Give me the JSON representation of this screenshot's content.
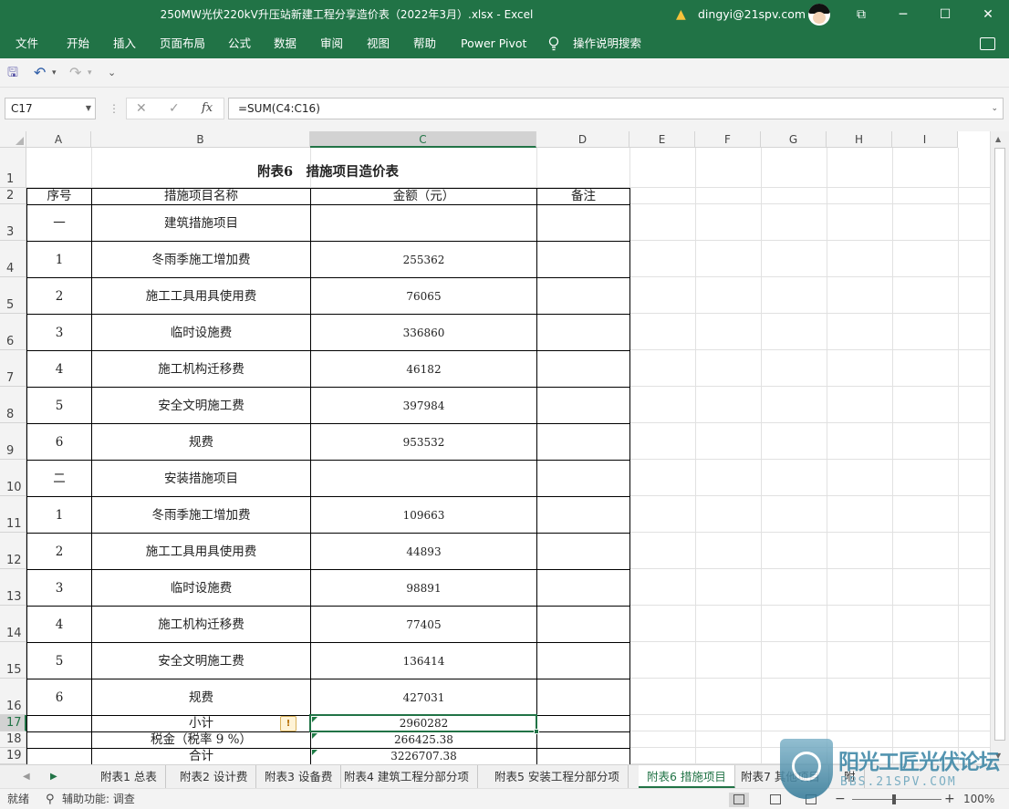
{
  "window": {
    "title": "250MW光伏220kV升压站新建工程分享造价表（2022年3月）.xlsx  -  Excel",
    "user": "dingyi@21spv.com",
    "min_glyph": "─",
    "restore_glyph": "☐",
    "close_glyph": "✕",
    "ribbon_toggle_glyph": "⧉"
  },
  "menu": [
    "文件",
    "开始",
    "插入",
    "页面布局",
    "公式",
    "数据",
    "审阅",
    "视图",
    "帮助",
    "Power Pivot",
    "操作说明搜索"
  ],
  "qat": {
    "undo": "↶",
    "redo": "↷",
    "more": "⌄",
    "save": "🖫"
  },
  "formula_bar": {
    "name_box": "C17",
    "cancel": "✕",
    "enter": "✓",
    "fx": "fx",
    "formula": "=SUM(C4:C16)"
  },
  "columns": [
    "A",
    "B",
    "C",
    "D",
    "E",
    "F",
    "G",
    "H",
    "I"
  ],
  "rows": [
    "1",
    "2",
    "3",
    "4",
    "5",
    "6",
    "7",
    "8",
    "9",
    "10",
    "11",
    "12",
    "13",
    "14",
    "15",
    "16",
    "17",
    "18",
    "19"
  ],
  "sheet": {
    "title": "附表6　措施项目造价表",
    "headers": [
      "序号",
      "措施项目名称",
      "金额（元）",
      "备注"
    ],
    "data": [
      [
        "一",
        "建筑措施项目",
        "",
        ""
      ],
      [
        "1",
        "冬雨季施工增加费",
        "255362",
        ""
      ],
      [
        "2",
        "施工工具用具使用费",
        "76065",
        ""
      ],
      [
        "3",
        "临时设施费",
        "336860",
        ""
      ],
      [
        "4",
        "施工机构迁移费",
        "46182",
        ""
      ],
      [
        "5",
        "安全文明施工费",
        "397984",
        ""
      ],
      [
        "6",
        "规费",
        "953532",
        ""
      ],
      [
        "二",
        "安装措施项目",
        "",
        ""
      ],
      [
        "1",
        "冬雨季施工增加费",
        "109663",
        ""
      ],
      [
        "2",
        "施工工具用具使用费",
        "44893",
        ""
      ],
      [
        "3",
        "临时设施费",
        "98891",
        ""
      ],
      [
        "4",
        "施工机构迁移费",
        "77405",
        ""
      ],
      [
        "5",
        "安全文明施工费",
        "136414",
        ""
      ],
      [
        "6",
        "规费",
        "427031",
        ""
      ],
      [
        "",
        "小计",
        "2960282",
        ""
      ],
      [
        "",
        "税金（税率 9 %）",
        "266425.38",
        ""
      ],
      [
        "",
        "合计",
        "3226707.38",
        ""
      ]
    ]
  },
  "tabs": [
    "附表1 总表",
    "附表2 设计费",
    "附表3 设备费",
    "附表4 建筑工程分部分项",
    "附表5 安装工程分部分项",
    "附表6 措施项目",
    "附表7 其他项目",
    "附"
  ],
  "active_tab": "附表6 措施项目",
  "status": {
    "ready": "就绪",
    "accessibility": "辅助功能: 调查",
    "zoom": "100%"
  },
  "watermark": {
    "brand": "阳光工匠光伏论坛",
    "url": "BBS.21SPV.COM"
  },
  "colors": {
    "accent": "#217346"
  }
}
